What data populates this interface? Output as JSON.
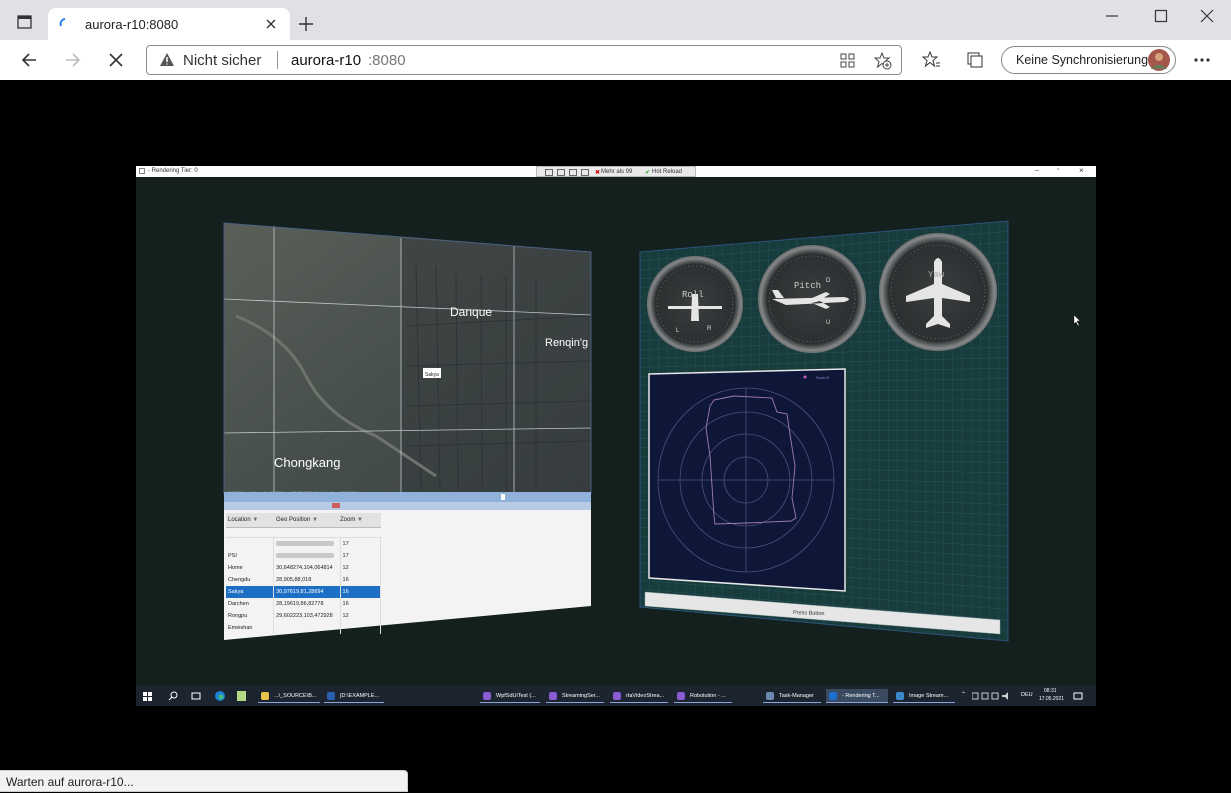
{
  "browser": {
    "tab_title": "aurora-r10:8080",
    "security_label": "Nicht sicher",
    "url_host": "aurora-r10",
    "url_port": ":8080",
    "sync_label": "Keine Synchronisierung",
    "status_text": "Warten auf aurora-r10..."
  },
  "app": {
    "window_title": "- Rendering Tier: 0",
    "toolbar_badge": "Mehr als 99",
    "hot_reload": "Hot Reload",
    "map": {
      "labels": [
        "Danque",
        "Renqin'g",
        "Chongkang",
        "Sakya"
      ],
      "copyright": "© 2021 Microsoft Corporation  © 2021 Maxar ©CNES (2021) Distribution Airbus DS  © 2021 Intermap"
    },
    "table": {
      "headers": [
        "Location",
        "Geo Position",
        "Zoom"
      ],
      "rows": [
        {
          "location": "",
          "geo": "",
          "zoom": "17"
        },
        {
          "location": "PSI",
          "geo": "",
          "zoom": "17"
        },
        {
          "location": "Home",
          "geo": "30,648274,104,064814",
          "zoom": "12"
        },
        {
          "location": "Chengdu",
          "geo": "28,905,88,018",
          "zoom": "16"
        },
        {
          "location": "Sakya",
          "geo": "30,97619,81,28694",
          "zoom": "16"
        },
        {
          "location": "Darchen",
          "geo": "28,19619,86,82778",
          "zoom": "16"
        },
        {
          "location": "Rongpu",
          "geo": "29,602223,103,472928",
          "zoom": "12"
        },
        {
          "location": "Emeishan",
          "geo": "",
          "zoom": ""
        }
      ],
      "selected_row": 4
    },
    "gauges": {
      "roll_label": "Roll",
      "pitch_label": "Pitch",
      "yaw_label": "Yaw",
      "roll_left": "L",
      "roll_right": "R",
      "pitch_up": "D",
      "pitch_down": "U"
    },
    "polar": {
      "legend": "Scan B"
    },
    "press_button": "Press Button"
  },
  "taskbar": {
    "items": [
      "...\\_SOURCE\\B...",
      "[D:\\EXAMPLE...",
      "WpfSdUiTest (...",
      "StreamingSer...",
      "rtaVideoStrea...",
      "Robolution - ...",
      "Task-Manager",
      "- Rendering T...",
      "Image Stream..."
    ],
    "lang": "DEU",
    "time": "08:31",
    "date": "17.05.2021"
  },
  "colors": {
    "app_bg": "#13201e",
    "selection": "#1c6fc4",
    "grid": "#2c5a68"
  }
}
